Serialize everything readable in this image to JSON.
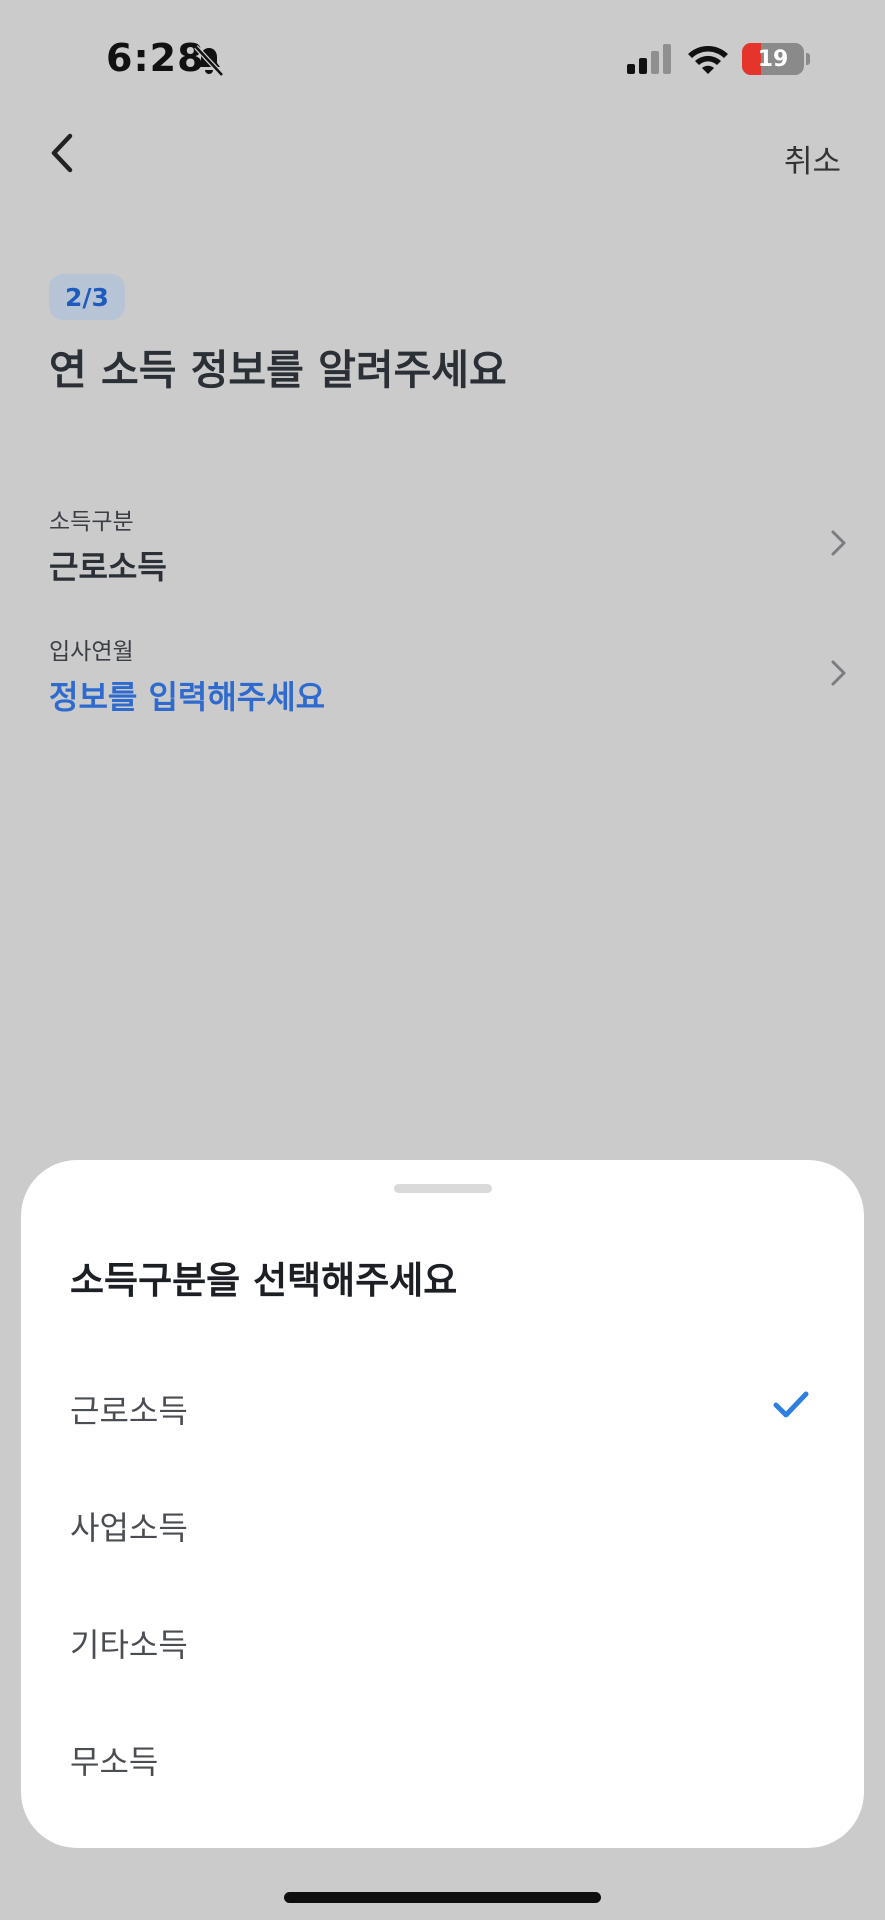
{
  "status_bar": {
    "time": "6:28",
    "battery_level": "19"
  },
  "nav": {
    "cancel_label": "취소"
  },
  "step": "2/3",
  "title": "연 소득 정보를 알려주세요",
  "fields": [
    {
      "label": "소득구분",
      "value": "근로소득"
    },
    {
      "label": "입사연월",
      "value": "정보를 입력해주세요"
    }
  ],
  "sheet": {
    "title": "소득구분을 선택해주세요",
    "options": [
      "근로소득",
      "사업소득",
      "기타소득",
      "무소득"
    ],
    "selected_index": 0
  },
  "colors": {
    "accent": "#2f6bcf",
    "background": "#cbcbcb",
    "sheet": "#ffffff"
  }
}
